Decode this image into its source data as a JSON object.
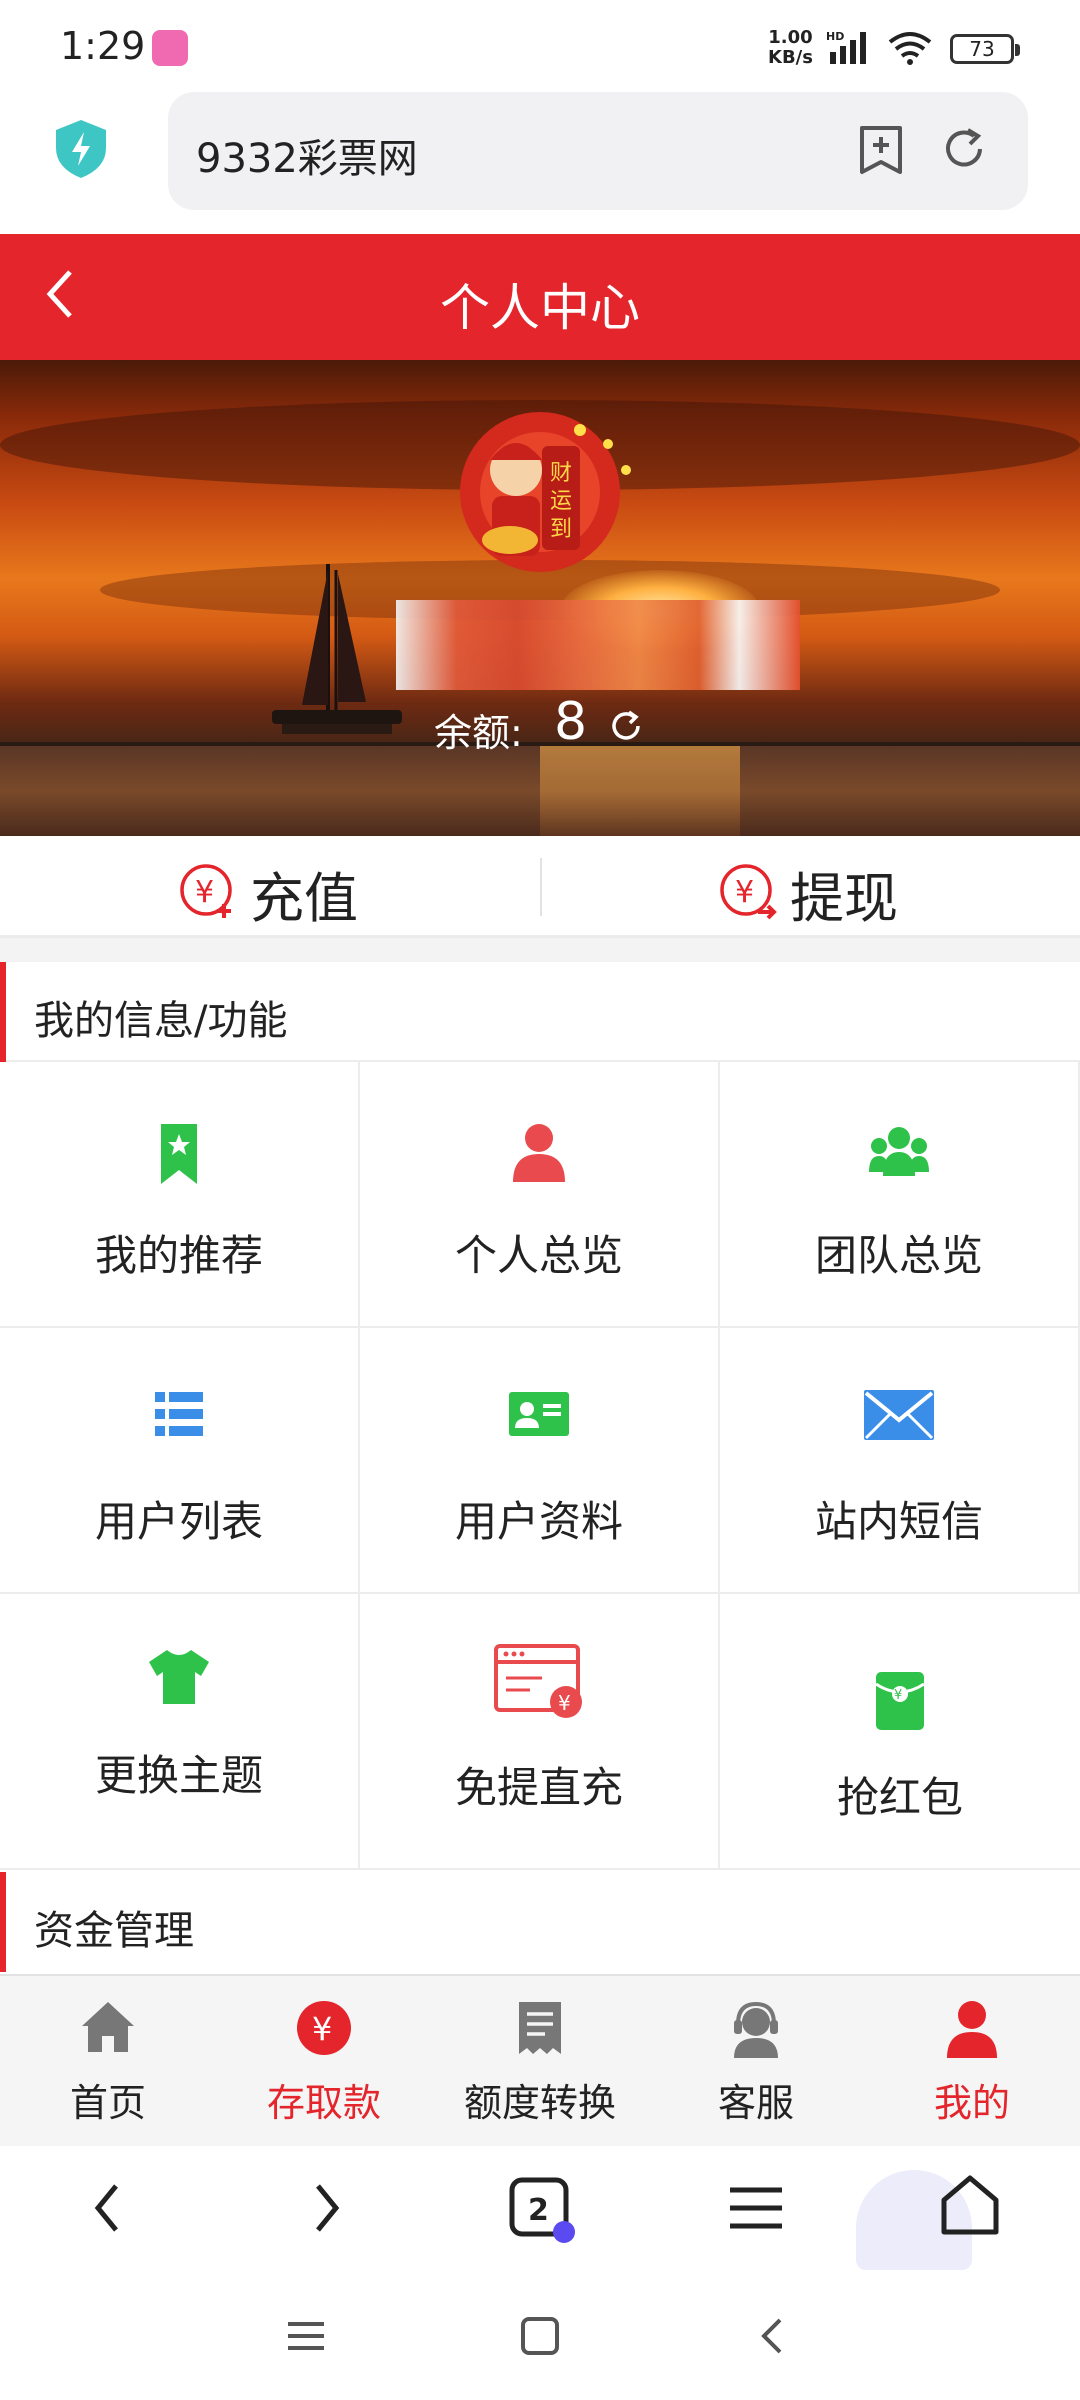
{
  "status": {
    "time": "1:29",
    "net_speed_value": "1.00",
    "net_speed_unit": "KB/s",
    "network_badge": "HD",
    "battery": "73"
  },
  "browser": {
    "url_text": "9332彩票网",
    "tab_count": "2"
  },
  "header": {
    "title": "个人中心"
  },
  "profile": {
    "balance_label": "余额:",
    "balance_value": "8"
  },
  "actions": {
    "recharge_label": "充值",
    "withdraw_label": "提现"
  },
  "sections": {
    "info": "我的信息/功能",
    "funds": "资金管理"
  },
  "grid": [
    {
      "label": "我的推荐",
      "icon": "bookmark-icon",
      "color": "#2ec24a"
    },
    {
      "label": "个人总览",
      "icon": "person-icon",
      "color": "#e84a4e"
    },
    {
      "label": "团队总览",
      "icon": "team-icon",
      "color": "#2ec24a"
    },
    {
      "label": "用户列表",
      "icon": "list-icon",
      "color": "#3a8ee8"
    },
    {
      "label": "用户资料",
      "icon": "id-card-icon",
      "color": "#2ec24a"
    },
    {
      "label": "站内短信",
      "icon": "envelope-icon",
      "color": "#3a8ee8"
    },
    {
      "label": "更换主题",
      "icon": "tshirt-icon",
      "color": "#2ec24a"
    },
    {
      "label": "免提直充",
      "icon": "payment-window-icon",
      "color": "#e84a4e"
    },
    {
      "label": "抢红包",
      "icon": "red-envelope-icon",
      "color": "#2ec24a"
    }
  ],
  "nav": [
    {
      "label": "首页",
      "icon": "home-icon"
    },
    {
      "label": "存取款",
      "icon": "yuan-circle-icon"
    },
    {
      "label": "额度转换",
      "icon": "receipt-icon"
    },
    {
      "label": "客服",
      "icon": "support-agent-icon"
    },
    {
      "label": "我的",
      "icon": "user-icon"
    }
  ],
  "colors": {
    "brand_red": "#e4262c",
    "green": "#2ec24a",
    "blue": "#3a8ee8"
  }
}
